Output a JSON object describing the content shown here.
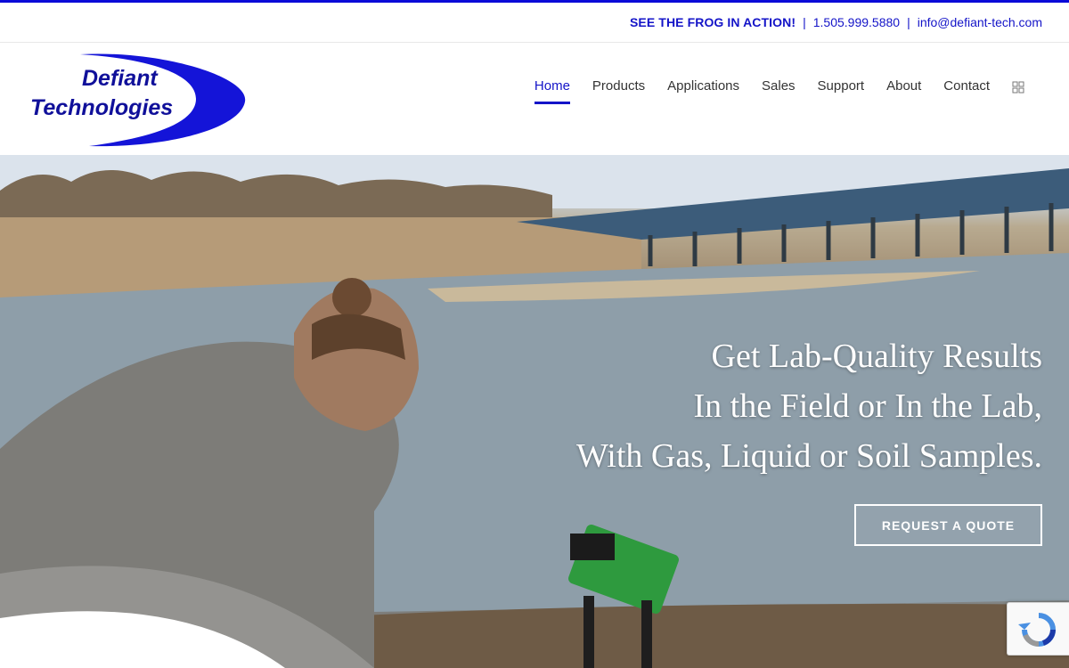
{
  "topbar": {
    "cta": "SEE THE FROG IN ACTION!",
    "separator": "|",
    "phone": "1.505.999.5880",
    "email": "info@defiant-tech.com"
  },
  "logo": {
    "line1": "Defiant",
    "line2": "Technologies"
  },
  "nav": {
    "items": [
      {
        "label": "Home",
        "active": true
      },
      {
        "label": "Products"
      },
      {
        "label": "Applications"
      },
      {
        "label": "Sales"
      },
      {
        "label": "Support"
      },
      {
        "label": "About"
      },
      {
        "label": "Contact"
      }
    ],
    "extra_icon": "grid-icon"
  },
  "hero": {
    "headline": [
      "Get Lab-Quality Results",
      "In the Field or In the Lab,",
      "With Gas, Liquid or Soil Samples."
    ],
    "button_label": "REQUEST A QUOTE"
  },
  "colors": {
    "brand_blue": "#1414c8",
    "text": "#333333"
  },
  "recaptcha_icon": "recaptcha-icon"
}
